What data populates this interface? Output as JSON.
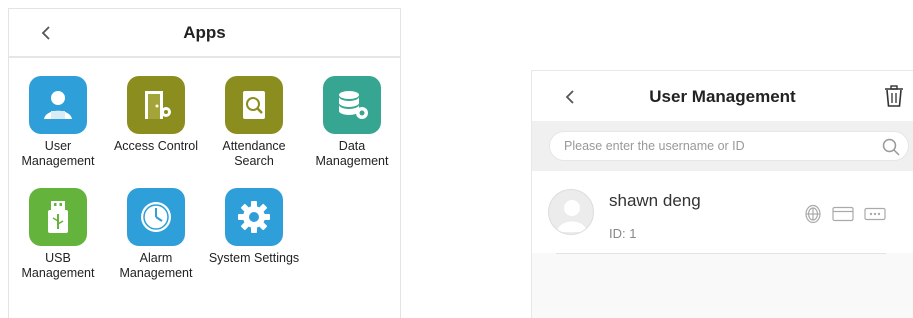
{
  "apps_screen": {
    "title": "Apps",
    "apps": [
      {
        "label": "User\nManagement",
        "icon": "user-management-icon",
        "color": "#2e9fd8"
      },
      {
        "label": "Access Control",
        "icon": "access-control-icon",
        "color": "#8b8d1f"
      },
      {
        "label": "Attendance\nSearch",
        "icon": "attendance-search-icon",
        "color": "#8b8d1f"
      },
      {
        "label": "Data\nManagement",
        "icon": "data-management-icon",
        "color": "#36a692"
      },
      {
        "label": "USB\nManagement",
        "icon": "usb-icon",
        "color": "#64b33d"
      },
      {
        "label": "Alarm\nManagement",
        "icon": "alarm-clock-icon",
        "color": "#2e9fd8"
      },
      {
        "label": "System Settings",
        "icon": "gear-icon",
        "color": "#2e9fd8"
      }
    ]
  },
  "user_management": {
    "title": "User Management",
    "search": {
      "placeholder": "Please enter the username or ID",
      "value": ""
    },
    "users": [
      {
        "name": "shawn deng",
        "id_text": "ID: 1",
        "verify_methods": [
          "fingerprint-icon",
          "card-icon",
          "password-icon"
        ]
      }
    ]
  }
}
